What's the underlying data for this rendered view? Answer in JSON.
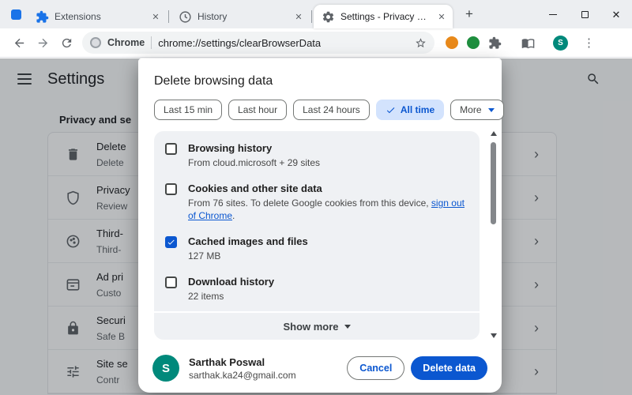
{
  "tabs": [
    {
      "label": "Extensions",
      "icon": "extensions-puzzle-icon"
    },
    {
      "label": "History",
      "icon": "history-clock-icon"
    },
    {
      "label": "Settings - Privacy and se",
      "icon": "settings-gear-icon",
      "active": true
    }
  ],
  "toolbar": {
    "site_chip_label": "Chrome",
    "url": "chrome://settings/clearBrowserData"
  },
  "settings_page": {
    "title": "Settings",
    "section_heading": "Privacy and se",
    "rows": [
      {
        "title": "Delete",
        "subtitle": "Delete",
        "icon": "trash-icon"
      },
      {
        "title": "Privacy",
        "subtitle": "Review",
        "icon": "shield-icon"
      },
      {
        "title": "Third-",
        "subtitle": "Third-",
        "icon": "cookie-icon"
      },
      {
        "title": "Ad pri",
        "subtitle": "Custo",
        "icon": "ads-icon"
      },
      {
        "title": "Securi",
        "subtitle": "Safe B",
        "icon": "lock-icon"
      },
      {
        "title": "Site se",
        "subtitle": "Contr",
        "icon": "tune-icon"
      }
    ]
  },
  "dialog": {
    "title": "Delete browsing data",
    "time_chips": [
      {
        "label": "Last 15 min",
        "selected": false
      },
      {
        "label": "Last hour",
        "selected": false
      },
      {
        "label": "Last 24 hours",
        "selected": false
      },
      {
        "label": "All time",
        "selected": true
      },
      {
        "label": "More",
        "selected": false,
        "dropdown": true
      }
    ],
    "items": [
      {
        "label": "Browsing history",
        "detail": "From cloud.microsoft + 29 sites",
        "checked": false
      },
      {
        "label": "Cookies and other site data",
        "detail_prefix": "From 76 sites. To delete Google cookies from this device, ",
        "link_text": "sign out of Chrome",
        "detail_suffix": ".",
        "checked": false
      },
      {
        "label": "Cached images and files",
        "detail": "127 MB",
        "checked": true
      },
      {
        "label": "Download history",
        "detail": "22 items",
        "checked": false
      }
    ],
    "show_more_label": "Show more",
    "account": {
      "name": "Sarthak Poswal",
      "email": "sarthak.ka24@gmail.com",
      "avatar_letter": "S"
    },
    "cancel_label": "Cancel",
    "delete_label": "Delete data"
  },
  "colors": {
    "accent_blue": "#0b57d0",
    "chip_selected_bg": "#d3e3fd",
    "avatar_teal": "#00897b",
    "extension_dot_orange": "#e8891a",
    "extension_dot_green": "#1e8e3e"
  }
}
